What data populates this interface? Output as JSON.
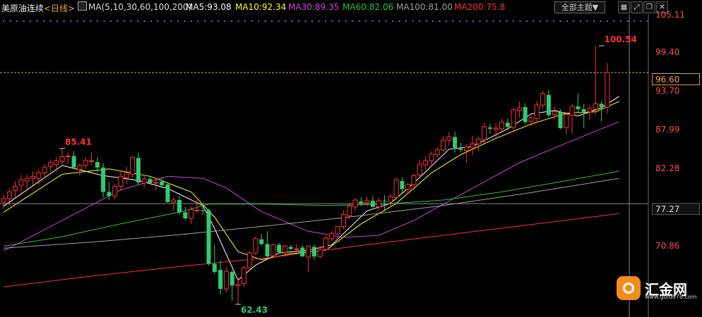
{
  "header": {
    "symbol": "美原油连续",
    "period": "<日线>",
    "ma_params": "MA(5,10,30,60,100,200)",
    "ma5": "MA5:93.08",
    "ma10": "MA10:92.34",
    "ma30": "MA30:89.35",
    "ma60": "MA60:82.06",
    "ma100": "MA100:81.00",
    "ma200": "MA200:75.8",
    "theme_button": "全部主题▼",
    "icons": [
      "grid-icon",
      "expand-icon",
      "restore-icon",
      "close-icon"
    ]
  },
  "colors": {
    "up": "#ff3232",
    "down": "#2ecc71",
    "ma5": "#ffffff",
    "ma10": "#ffff00",
    "ma30": "#d040e0",
    "ma60": "#30c030",
    "ma100": "#a0a0a0",
    "ma200": "#ff3030"
  },
  "labels": {
    "high": "85.41",
    "low": "62.43",
    "recent_high": "100.54",
    "current_price": "96.60",
    "crosshair_price": "77.27"
  },
  "yaxis": [
    "105.11",
    "99.40",
    "93.70",
    "87.99",
    "82.28",
    "70.86"
  ],
  "logo": {
    "name": "汇金网",
    "url": "www.gold678.com"
  },
  "chart_data": {
    "type": "candlestick",
    "y_ticks": [
      105.11,
      99.4,
      93.7,
      87.99,
      82.28,
      70.86
    ],
    "ylim": [
      62.0,
      106.5
    ],
    "candles": [
      [
        77.5,
        78.6,
        76.5,
        78.0
      ],
      [
        78.0,
        79.5,
        77.0,
        79.0
      ],
      [
        79.2,
        80.6,
        78.2,
        79.8
      ],
      [
        80.0,
        81.5,
        78.5,
        80.8
      ],
      [
        80.6,
        81.6,
        79.1,
        81.0
      ],
      [
        81.0,
        82.0,
        80.0,
        81.3
      ],
      [
        81.0,
        82.3,
        80.1,
        81.8
      ],
      [
        81.8,
        83.1,
        81.0,
        82.6
      ],
      [
        82.8,
        83.8,
        82.0,
        83.3
      ],
      [
        83.0,
        84.1,
        81.9,
        83.6
      ],
      [
        83.5,
        85.41,
        82.9,
        84.2
      ],
      [
        84.2,
        84.8,
        83.2,
        84.3
      ],
      [
        84.3,
        85.0,
        82.8,
        82.6
      ],
      [
        82.3,
        83.2,
        81.4,
        82.9
      ],
      [
        82.9,
        84.1,
        82.4,
        83.6
      ],
      [
        83.6,
        84.8,
        83.0,
        83.6
      ],
      [
        83.4,
        84.1,
        81.9,
        82.6
      ],
      [
        82.6,
        83.2,
        78.2,
        79.0
      ],
      [
        79.0,
        80.5,
        77.8,
        78.4
      ],
      [
        78.4,
        80.2,
        77.9,
        79.8
      ],
      [
        79.8,
        82.0,
        79.2,
        81.3
      ],
      [
        81.1,
        82.7,
        80.2,
        81.8
      ],
      [
        81.6,
        84.2,
        81.1,
        84.1
      ],
      [
        84.0,
        84.8,
        80.1,
        80.4
      ],
      [
        80.3,
        81.5,
        79.6,
        80.9
      ],
      [
        80.9,
        81.2,
        80.1,
        80.3
      ],
      [
        80.3,
        81.0,
        79.2,
        80.4
      ],
      [
        80.5,
        81.2,
        79.6,
        80.0
      ],
      [
        80.1,
        80.2,
        77.4,
        77.5
      ],
      [
        77.5,
        78.2,
        76.3,
        77.8
      ],
      [
        77.8,
        78.4,
        75.6,
        76.0
      ],
      [
        76.0,
        76.8,
        74.9,
        75.1
      ],
      [
        75.1,
        76.9,
        74.3,
        76.4
      ],
      [
        76.3,
        77.8,
        75.8,
        76.3
      ],
      [
        76.3,
        77.1,
        75.6,
        76.2
      ],
      [
        76.3,
        76.5,
        68.1,
        68.4
      ],
      [
        68.4,
        71.2,
        66.9,
        67.2
      ],
      [
        67.5,
        68.9,
        63.9,
        64.7
      ],
      [
        64.7,
        67.9,
        64.2,
        67.3
      ],
      [
        67.2,
        67.5,
        63.0,
        65.2
      ],
      [
        65.2,
        66.3,
        62.43,
        65.4
      ],
      [
        65.5,
        68.1,
        65.0,
        67.8
      ],
      [
        67.8,
        70.3,
        67.5,
        70.0
      ],
      [
        70.0,
        72.4,
        69.7,
        72.1
      ],
      [
        72.0,
        72.8,
        71.1,
        71.3
      ],
      [
        71.3,
        73.2,
        69.4,
        69.5
      ],
      [
        69.6,
        71.3,
        69.5,
        71.2
      ],
      [
        71.2,
        71.5,
        69.9,
        70.1
      ],
      [
        70.1,
        71.2,
        69.4,
        71.0
      ],
      [
        70.9,
        71.2,
        70.4,
        70.6
      ],
      [
        70.5,
        71.3,
        70.1,
        70.6
      ],
      [
        70.8,
        71.2,
        69.4,
        69.5
      ],
      [
        69.4,
        71.1,
        67.2,
        71.0
      ],
      [
        70.9,
        71.3,
        69.0,
        69.5
      ],
      [
        69.5,
        71.0,
        69.2,
        70.5
      ],
      [
        70.5,
        72.5,
        70.3,
        72.2
      ],
      [
        72.1,
        73.2,
        71.8,
        72.9
      ],
      [
        72.8,
        74.0,
        72.6,
        73.9
      ],
      [
        73.9,
        76.3,
        73.5,
        75.7
      ],
      [
        75.5,
        77.3,
        75.0,
        76.9
      ],
      [
        76.8,
        78.1,
        76.2,
        77.8
      ],
      [
        77.6,
        78.2,
        76.9,
        77.3
      ],
      [
        77.4,
        78.3,
        76.9,
        77.7
      ],
      [
        77.7,
        78.4,
        76.7,
        76.8
      ],
      [
        76.8,
        78.1,
        76.2,
        77.7
      ],
      [
        77.7,
        78.5,
        76.1,
        77.6
      ],
      [
        77.5,
        78.7,
        76.9,
        78.3
      ],
      [
        78.2,
        81.1,
        77.9,
        80.8
      ],
      [
        80.6,
        81.2,
        78.9,
        79.4
      ],
      [
        79.4,
        80.3,
        78.7,
        80.1
      ],
      [
        80.1,
        81.7,
        79.3,
        81.4
      ],
      [
        81.5,
        83.8,
        81.1,
        83.1
      ],
      [
        83.0,
        84.2,
        82.3,
        83.6
      ],
      [
        83.6,
        85.0,
        82.8,
        84.6
      ],
      [
        84.5,
        85.6,
        84.0,
        85.2
      ],
      [
        85.2,
        87.2,
        84.9,
        86.6
      ],
      [
        86.6,
        87.8,
        85.8,
        87.1
      ],
      [
        87.1,
        87.9,
        84.8,
        85.5
      ],
      [
        85.4,
        86.2,
        84.9,
        85.2
      ],
      [
        85.1,
        86.1,
        83.2,
        85.6
      ],
      [
        85.5,
        87.3,
        84.4,
        86.1
      ],
      [
        86.1,
        87.1,
        85.0,
        86.8
      ],
      [
        86.7,
        89.2,
        86.1,
        88.6
      ],
      [
        88.5,
        89.0,
        87.6,
        88.3
      ],
      [
        88.2,
        89.1,
        87.0,
        88.4
      ],
      [
        88.3,
        89.8,
        87.8,
        89.3
      ],
      [
        89.2,
        89.8,
        88.1,
        88.6
      ],
      [
        88.5,
        91.4,
        88.0,
        91.1
      ],
      [
        91.0,
        92.3,
        89.9,
        91.4
      ],
      [
        91.5,
        92.1,
        89.0,
        89.3
      ],
      [
        89.4,
        90.2,
        88.7,
        89.9
      ],
      [
        89.8,
        92.4,
        89.2,
        91.8
      ],
      [
        91.8,
        93.9,
        91.3,
        93.5
      ],
      [
        93.3,
        94.0,
        90.1,
        90.3
      ],
      [
        90.4,
        91.5,
        89.7,
        90.8
      ],
      [
        90.8,
        91.2,
        88.3,
        88.4
      ],
      [
        88.5,
        90.8,
        87.5,
        90.4
      ],
      [
        90.3,
        92.0,
        87.6,
        91.6
      ],
      [
        91.6,
        93.5,
        90.7,
        91.2
      ],
      [
        91.2,
        92.0,
        88.5,
        90.8
      ],
      [
        90.8,
        91.8,
        89.6,
        91.3
      ],
      [
        91.2,
        100.54,
        90.4,
        92.0
      ],
      [
        92.0,
        92.4,
        89.4,
        91.5
      ],
      [
        91.5,
        98.0,
        90.6,
        96.6
      ]
    ],
    "ma_lines": {
      "ma5": [
        [
          0,
          76.9
        ],
        [
          10,
          82.9
        ],
        [
          17,
          81.4
        ],
        [
          23,
          80.7
        ],
        [
          28,
          79.5
        ],
        [
          34,
          77.0
        ],
        [
          36,
          73.6
        ],
        [
          40,
          66.0
        ],
        [
          43,
          68.2
        ],
        [
          47,
          70.0
        ],
        [
          52,
          70.4
        ],
        [
          56,
          71.2
        ],
        [
          62,
          76.2
        ],
        [
          66,
          77.3
        ],
        [
          70,
          80.3
        ],
        [
          76,
          85.3
        ],
        [
          80,
          85.7
        ],
        [
          86,
          88.3
        ],
        [
          90,
          90.5
        ],
        [
          94,
          91.0
        ],
        [
          98,
          90.2
        ],
        [
          102,
          91.4
        ],
        [
          105,
          93.08
        ]
      ],
      "ma10": [
        [
          0,
          76.0
        ],
        [
          10,
          81.6
        ],
        [
          18,
          82.4
        ],
        [
          25,
          81.3
        ],
        [
          32,
          79.0
        ],
        [
          36,
          75.3
        ],
        [
          40,
          70.2
        ],
        [
          44,
          69.0
        ],
        [
          49,
          69.9
        ],
        [
          55,
          70.4
        ],
        [
          61,
          74.3
        ],
        [
          67,
          77.3
        ],
        [
          73,
          81.8
        ],
        [
          78,
          84.5
        ],
        [
          84,
          86.9
        ],
        [
          90,
          89.0
        ],
        [
          96,
          90.6
        ],
        [
          101,
          90.8
        ],
        [
          105,
          92.34
        ]
      ],
      "ma30": [
        [
          0,
          70.3
        ],
        [
          10,
          74.8
        ],
        [
          20,
          79.3
        ],
        [
          28,
          81.3
        ],
        [
          34,
          81.0
        ],
        [
          38,
          79.6
        ],
        [
          44,
          76.1
        ],
        [
          52,
          73.2
        ],
        [
          58,
          72.3
        ],
        [
          64,
          72.6
        ],
        [
          70,
          74.8
        ],
        [
          78,
          78.6
        ],
        [
          88,
          83.3
        ],
        [
          96,
          86.2
        ],
        [
          105,
          89.35
        ]
      ],
      "ma60": [
        [
          0,
          71.0
        ],
        [
          10,
          72.4
        ],
        [
          20,
          74.3
        ],
        [
          30,
          76.0
        ],
        [
          35,
          77.2
        ],
        [
          45,
          77.2
        ],
        [
          55,
          77.0
        ],
        [
          65,
          77.2
        ],
        [
          75,
          77.8
        ],
        [
          85,
          79.0
        ],
        [
          95,
          80.5
        ],
        [
          105,
          82.06
        ]
      ],
      "ma100": [
        [
          0,
          70.7
        ],
        [
          15,
          71.6
        ],
        [
          30,
          72.7
        ],
        [
          45,
          74.0
        ],
        [
          60,
          75.4
        ],
        [
          75,
          77.0
        ],
        [
          90,
          78.9
        ],
        [
          105,
          81.0
        ]
      ],
      "ma200": [
        [
          0,
          65.0
        ],
        [
          15,
          66.6
        ],
        [
          30,
          68.0
        ],
        [
          45,
          69.3
        ],
        [
          60,
          71.0
        ],
        [
          75,
          72.6
        ],
        [
          90,
          74.2
        ],
        [
          105,
          75.8
        ]
      ]
    },
    "markers": [
      {
        "index": 10,
        "value": 85.41,
        "label": "85.41"
      },
      {
        "index": 40,
        "value": 62.43,
        "label": "62.43"
      },
      {
        "index": 102,
        "value": 100.54,
        "label": "100.54"
      }
    ],
    "current_price": 96.6,
    "crosshair_price": 77.27,
    "grid": false
  }
}
